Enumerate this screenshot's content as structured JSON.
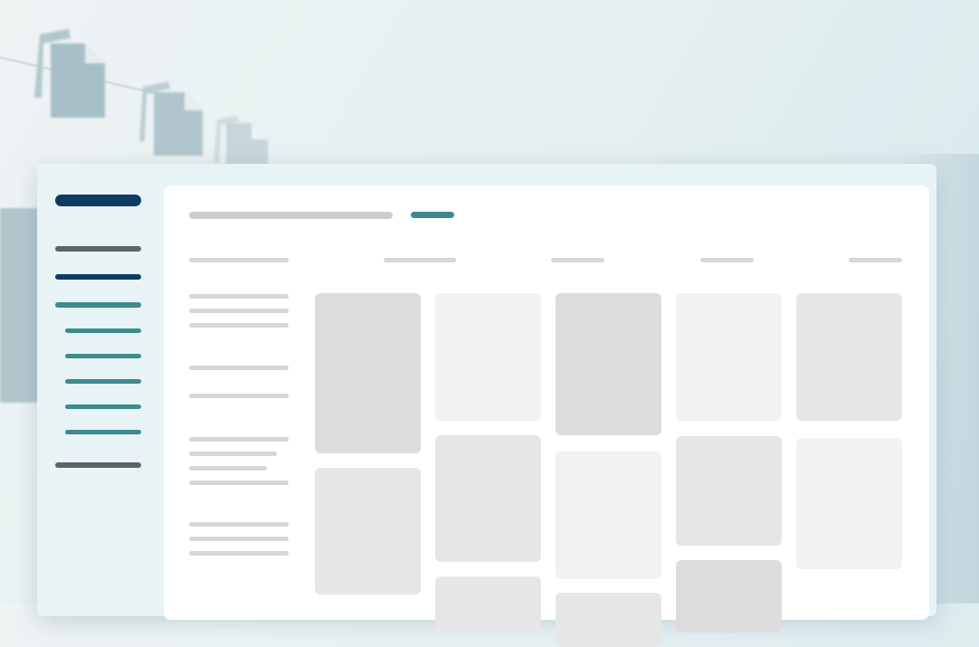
{
  "background": {
    "icons": [
      "document-stack-icon",
      "document-stack-icon",
      "document-stack-icon"
    ]
  },
  "sidebar": {
    "logo_placeholder": "placeholder-bar",
    "items": [
      {
        "state": "default",
        "color": "#5c6468"
      },
      {
        "state": "section",
        "color": "#0f3a63"
      },
      {
        "state": "active-parent",
        "color": "#3d8a8f"
      },
      {
        "state": "sub-item",
        "color": "#3d8a8f"
      },
      {
        "state": "sub-item",
        "color": "#3d8a8f"
      },
      {
        "state": "sub-item",
        "color": "#3d8a8f"
      },
      {
        "state": "sub-item",
        "color": "#3d8a8f"
      },
      {
        "state": "sub-item",
        "color": "#3d8a8f"
      },
      {
        "state": "default",
        "color": "#5c6468"
      }
    ]
  },
  "header": {
    "title_color": "#cccccc",
    "tag_color": "#3d8a8f"
  },
  "colors": {
    "accent_teal": "#3d8a8f",
    "brand_navy": "#0f3a63",
    "skeleton": "#d6d6d6",
    "card_dark": "#dcdcdc",
    "card_mid": "#e6e6e6",
    "card_light": "#f2f2f2"
  },
  "board": {
    "columns": 5,
    "row_label_groups": 5
  }
}
